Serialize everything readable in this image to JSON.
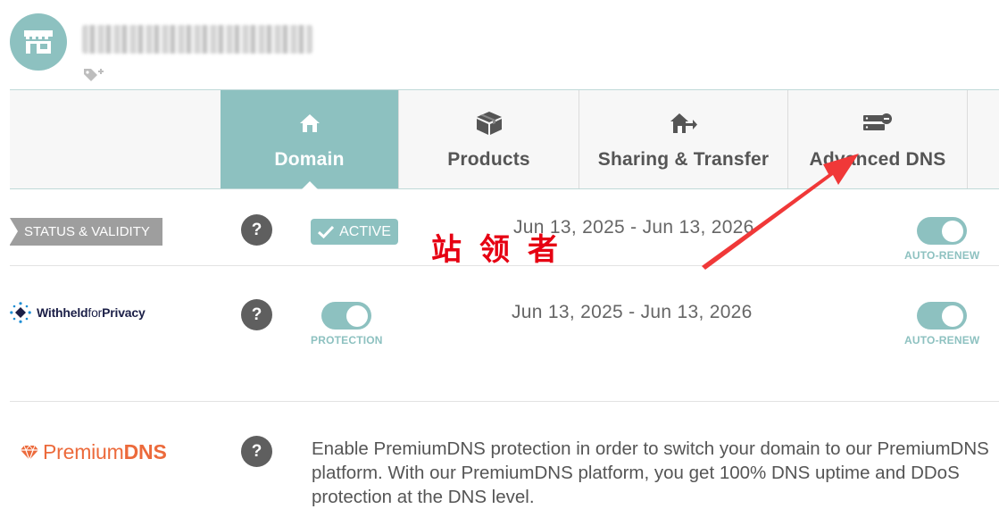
{
  "header": {
    "avatar_icon": "storefront-icon",
    "tag_add_icon": "tag-plus-icon"
  },
  "tabs": [
    {
      "label": "Domain",
      "icon": "home-icon",
      "active": true
    },
    {
      "label": "Products",
      "icon": "box-icon",
      "active": false
    },
    {
      "label": "Sharing & Transfer",
      "icon": "house-arrow-icon",
      "active": false
    },
    {
      "label": "Advanced DNS",
      "icon": "server-icon",
      "active": false
    }
  ],
  "status_row": {
    "label": "STATUS & VALIDITY",
    "help": "?",
    "badge": "ACTIVE",
    "dates": "Jun 13, 2025 - Jun 13, 2026",
    "auto_renew_label": "AUTO-RENEW"
  },
  "privacy_row": {
    "logo_bold": "Withheld",
    "logo_light": "for",
    "logo_bold2": "Privacy",
    "help": "?",
    "protection_label": "PROTECTION",
    "dates": "Jun 13, 2025 - Jun 13, 2026",
    "auto_renew_label": "AUTO-RENEW"
  },
  "premium_row": {
    "logo_light": "Premium",
    "logo_bold": "DNS",
    "help": "?",
    "description": "Enable PremiumDNS protection in order to switch your domain to our PremiumDNS platform. With our PremiumDNS platform, you get 100% DNS uptime and DDoS protection at the DNS level."
  },
  "annotation": {
    "watermark": "站领者"
  },
  "colors": {
    "accent": "#8dc1c0",
    "help_bg": "#5f5f5f",
    "status_label_bg": "#9e9e9e",
    "premium_orange": "#ec6a3b",
    "arrow_red": "#f03838"
  }
}
